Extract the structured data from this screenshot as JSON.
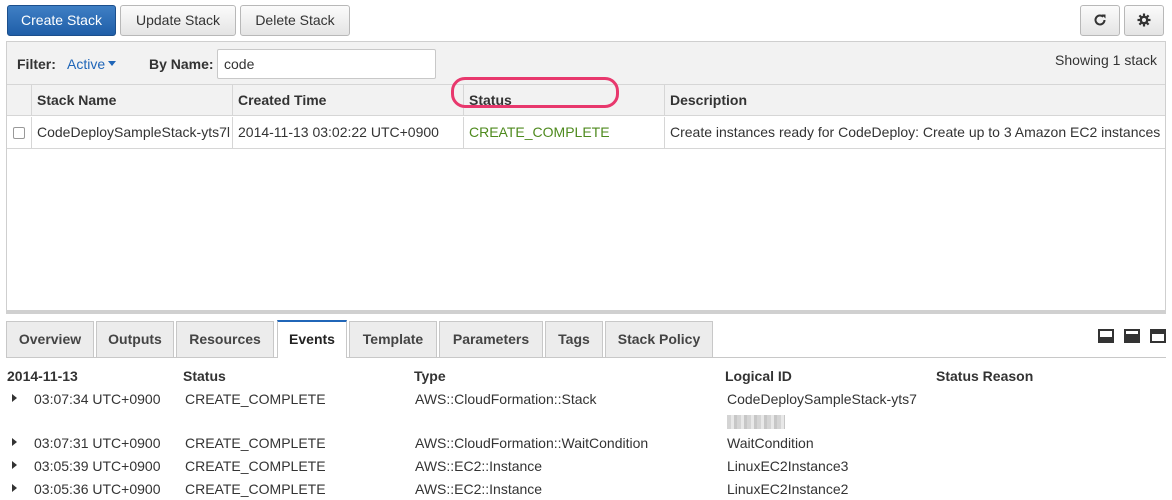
{
  "toolbar": {
    "create_label": "Create Stack",
    "update_label": "Update Stack",
    "delete_label": "Delete Stack",
    "refresh_icon": "refresh-icon",
    "settings_icon": "gear-icon"
  },
  "filter": {
    "label": "Filter:",
    "value": "Active",
    "by_name_label": "By Name:",
    "by_name_value": "code",
    "showing": "Showing 1 stack"
  },
  "stacks": {
    "columns": [
      "Stack Name",
      "Created Time",
      "Status",
      "Description"
    ],
    "rows": [
      {
        "name": "CodeDeploySampleStack-yts7l",
        "created": "2014-11-13 03:02:22 UTC+0900",
        "status": "CREATE_COMPLETE",
        "description": "Create instances ready for CodeDeploy: Create up to 3 Amazon EC2 instances"
      }
    ]
  },
  "tabs": [
    "Overview",
    "Outputs",
    "Resources",
    "Events",
    "Template",
    "Parameters",
    "Tags",
    "Stack Policy"
  ],
  "active_tab": "Events",
  "events": {
    "date": "2014-11-13",
    "columns": [
      "Status",
      "Type",
      "Logical ID",
      "Status Reason"
    ],
    "rows": [
      {
        "time": "03:07:34 UTC+0900",
        "status": "CREATE_COMPLETE",
        "type": "AWS::CloudFormation::Stack",
        "logical_id": "CodeDeploySampleStack-yts7"
      },
      {
        "time": "03:07:31 UTC+0900",
        "status": "CREATE_COMPLETE",
        "type": "AWS::CloudFormation::WaitCondition",
        "logical_id": "WaitCondition"
      },
      {
        "time": "03:05:39 UTC+0900",
        "status": "CREATE_COMPLETE",
        "type": "AWS::EC2::Instance",
        "logical_id": "LinuxEC2Instance3"
      },
      {
        "time": "03:05:36 UTC+0900",
        "status": "CREATE_COMPLETE",
        "type": "AWS::EC2::Instance",
        "logical_id": "LinuxEC2Instance2"
      }
    ]
  },
  "colors": {
    "primary": "#1f5ea8",
    "link": "#2066b8",
    "status_complete": "#4e8a1e",
    "highlight": "#e8386d"
  }
}
